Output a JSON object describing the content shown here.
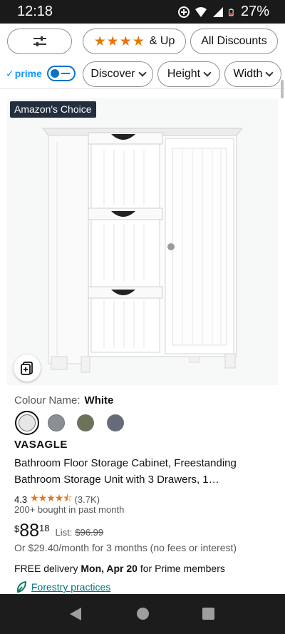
{
  "status_bar": {
    "time": "12:18",
    "battery": "27%"
  },
  "filters": {
    "rating_label": "& Up",
    "rating_stars": "★★★★",
    "discounts_label": "All Discounts",
    "prime_label": "prime",
    "discover_label": "Discover",
    "height_label": "Height",
    "width_label": "Width"
  },
  "product": {
    "badge": "Amazon's Choice",
    "colour_label": "Colour Name:",
    "colour_value": "White",
    "swatches": [
      {
        "name": "White",
        "color": "#e6e6e6"
      },
      {
        "name": "Grey",
        "color": "#8a9096"
      },
      {
        "name": "Green",
        "color": "#6b7359"
      },
      {
        "name": "Slate",
        "color": "#666a7a"
      }
    ],
    "brand": "VASAGLE",
    "title": "Bathroom Floor Storage Cabinet, Freestanding Bathroom Storage Unit with 3 Drawers, 1…",
    "rating_value": "4.3",
    "rating_stars": "★★★★⯪",
    "rating_count": "(3.7K)",
    "bought": "200+ bought in past month",
    "price_currency": "$",
    "price_whole": "88",
    "price_fraction": "18",
    "list_label": "List:",
    "list_price": "$96.99",
    "monthly": "Or $29.40/month for 3 months (no fees or interest)",
    "delivery_prefix": "FREE delivery",
    "delivery_date": "Mon, Apr 20",
    "delivery_suffix": "for Prime members",
    "forestry": "Forestry practices"
  },
  "colors": {
    "accent_link": "#007185",
    "star": "#de7921",
    "badge_bg": "#232f3e"
  }
}
